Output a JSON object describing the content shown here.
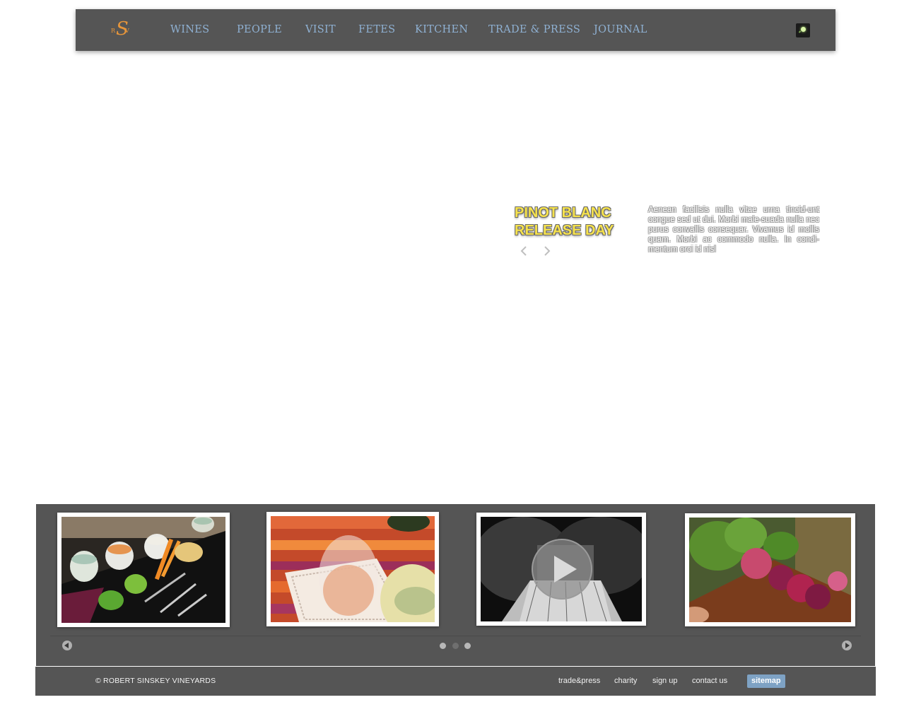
{
  "header": {
    "logo": {
      "r": "R",
      "s": "S",
      "v": "V"
    },
    "nav": [
      "WINES",
      "PEOPLE",
      "VISIT",
      "FETES",
      "KITCHEN",
      "TRADE & PRESS",
      "JOURNAL"
    ],
    "search_icon": "search-icon",
    "nav_color": "#8fb1d3"
  },
  "hero": {
    "title_line1": "PINOT BLANC",
    "title_line2": "RELEASE DAY",
    "body": "Aenean facilisis nulla vitae urna tincid-unt congue sed ut dui. Morbi male-suada nulla nec purus convallis consequar. Vivamus id mollis quam. Morbi ac commodo nulla. In condi-mentum orci id nisl",
    "prev_icon": "chevron-left-icon",
    "next_icon": "chevron-right-icon",
    "title_color": "#f6e24d"
  },
  "carousel": {
    "thumbnails": [
      {
        "subject": "appetizer platter with dips and vegetables"
      },
      {
        "subject": "glass of rose wine on striped placemat"
      },
      {
        "subject": "black and white wine glass video",
        "has_play_icon": true
      },
      {
        "subject": "radishes on wooden board"
      }
    ],
    "pages": 3,
    "active_page": 1,
    "prev_icon": "arrow-left-icon",
    "next_icon": "arrow-right-icon"
  },
  "footer": {
    "copyright": "© ROBERT SINSKEY VINEYARDS",
    "links": [
      "trade&press",
      "charity",
      "sign up",
      "contact us"
    ],
    "sitemap": "sitemap",
    "sitemap_color": "#7ea2c4"
  }
}
